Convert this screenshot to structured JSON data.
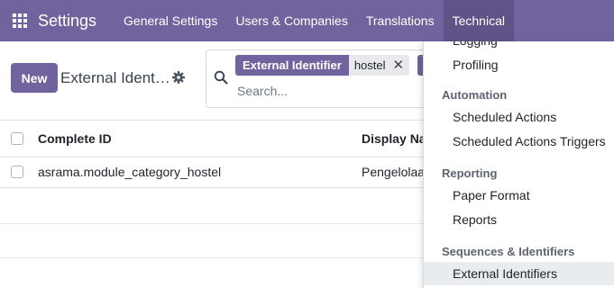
{
  "navbar": {
    "brand": "Settings",
    "menus": [
      "General Settings",
      "Users & Companies",
      "Translations",
      "Technical"
    ],
    "active_menu": "Technical",
    "color": "#71639e"
  },
  "control_panel": {
    "new_label": "New",
    "breadcrumb": "External Ident…"
  },
  "search": {
    "facet_label": "External Identifier",
    "facet_value": "hostel",
    "placeholder": "Search..."
  },
  "list": {
    "columns": [
      "Complete ID",
      "Display Na"
    ],
    "rows": [
      [
        "asrama.module_category_hostel",
        "Pengelolaa"
      ]
    ]
  },
  "technical_menu": {
    "cut_item": "Logging",
    "items_top": [
      "Profiling"
    ],
    "sections": [
      {
        "title": "Automation",
        "items": [
          "Scheduled Actions",
          "Scheduled Actions Triggers"
        ]
      },
      {
        "title": "Reporting",
        "items": [
          "Paper Format",
          "Reports"
        ]
      },
      {
        "title": "Sequences & Identifiers",
        "items": [
          "External Identifiers"
        ]
      }
    ],
    "selected_item": "External Identifiers"
  },
  "icons": [
    "apps-grid-icon",
    "gear-icon",
    "search-icon",
    "close-icon"
  ]
}
